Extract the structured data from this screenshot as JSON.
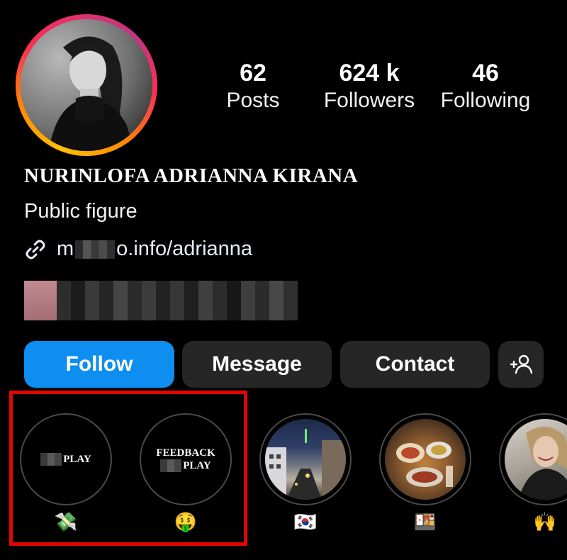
{
  "profile": {
    "display_name": "NURINLOFA ADRIANNA KIRANA",
    "category": "Public figure",
    "link_prefix": "m",
    "link_suffix": "o.info/adrianna"
  },
  "stats": {
    "posts": {
      "value": "62",
      "label": "Posts"
    },
    "followers": {
      "value": "624 k",
      "label": "Followers"
    },
    "following": {
      "value": "46",
      "label": "Following"
    }
  },
  "actions": {
    "follow_label": "Follow",
    "message_label": "Message",
    "contact_label": "Contact",
    "suggest_label": "+person-icon"
  },
  "highlights": [
    {
      "cover_line1": "",
      "cover_line2": "PLAY",
      "emoji": "💸"
    },
    {
      "cover_line1": "FEEDBACK",
      "cover_line2": "PLAY",
      "emoji": "🤑"
    },
    {
      "cover_image": "city street at night",
      "emoji": "🇰🇷"
    },
    {
      "cover_image": "food table",
      "emoji": "🍱"
    },
    {
      "cover_image": "woman portrait",
      "emoji": "🙌"
    }
  ],
  "colors": {
    "background": "#000000",
    "follow_button": "#0d8ef0",
    "secondary_button": "#262626",
    "highlight_box": "#e10600"
  }
}
